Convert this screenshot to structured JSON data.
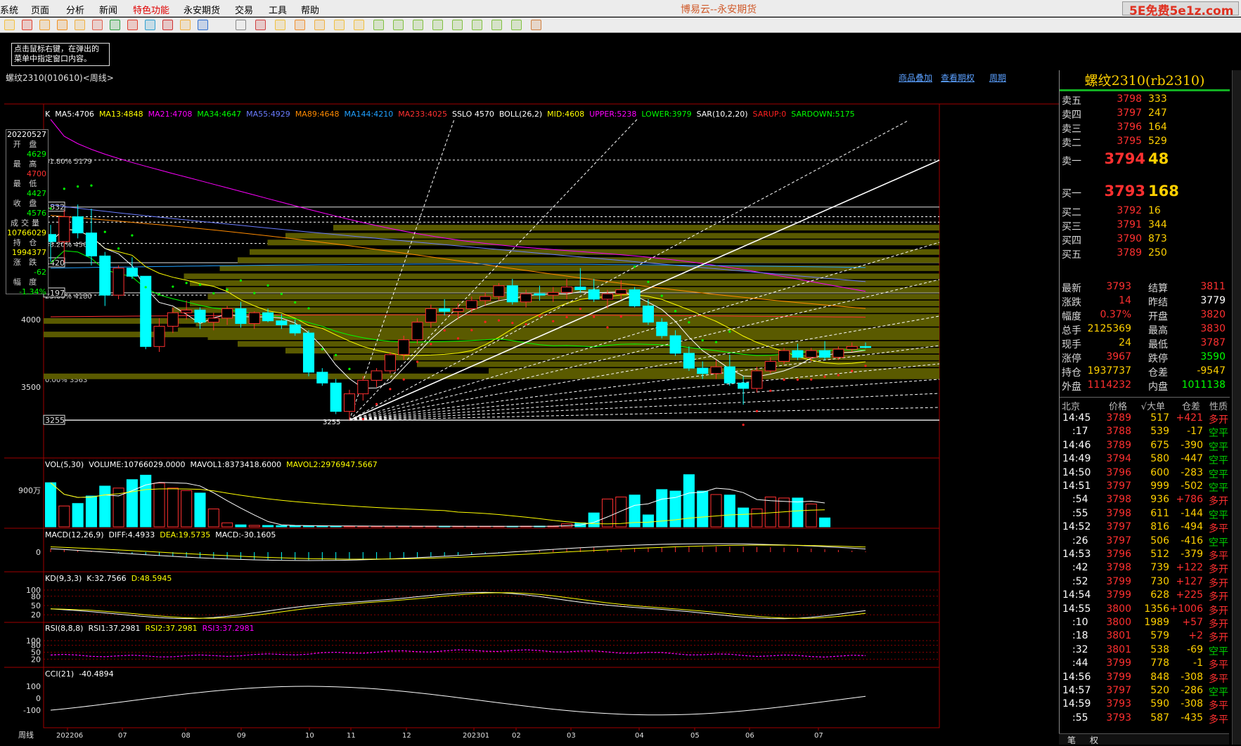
{
  "app": {
    "title": "博易云--永安期货",
    "watermark": "5E免费5e1z.com"
  },
  "menu": [
    "系统",
    "页面",
    "分析",
    "新闻",
    "特色功能",
    "永安期货",
    "交易",
    "工具",
    "帮助"
  ],
  "hint": {
    "line1": "点击鼠标右键，在弹出的",
    "line2": "菜单中指定窗口内容。"
  },
  "chart": {
    "title": "螺纹2310(010610)<周线>",
    "links": [
      "商品叠加",
      "查看期权",
      "周期"
    ],
    "ma_legend": [
      {
        "t": "K",
        "c": "#ffffff"
      },
      {
        "t": "MA5:4706",
        "c": "#ffffff"
      },
      {
        "t": "MA13:4848",
        "c": "#ffff00"
      },
      {
        "t": "MA21:4708",
        "c": "#ff00ff"
      },
      {
        "t": "MA34:4647",
        "c": "#00ff00"
      },
      {
        "t": "MA55:4929",
        "c": "#6a7cff"
      },
      {
        "t": "MA89:4648",
        "c": "#ff8a00"
      },
      {
        "t": "MA144:4210",
        "c": "#20a0ff"
      },
      {
        "t": "MA233:4025",
        "c": "#ff3030"
      },
      {
        "t": "SSLO 4570",
        "c": "#ffffff"
      },
      {
        "t": "BOLL(26,2)",
        "c": "#ffffff"
      },
      {
        "t": "MID:4608",
        "c": "#ffff00"
      },
      {
        "t": "UPPER:5238",
        "c": "#ff00ff"
      },
      {
        "t": "LOWER:3979",
        "c": "#00ff00"
      },
      {
        "t": "SAR(10,2,20)",
        "c": "#ffffff"
      },
      {
        "t": "SARUP:0",
        "c": "#ff2020"
      },
      {
        "t": "SARDOWN:5175",
        "c": "#00ff00"
      }
    ],
    "price_labels": [
      "4000",
      "3500"
    ],
    "price_boxes": [
      "4832",
      "4420",
      "4197",
      "3255"
    ],
    "fib": [
      "61.80% 5179",
      "38.20% 4562",
      "23.60% 4180",
      "0.00% 3563"
    ],
    "low_mark": "3255",
    "vol_legend": [
      {
        "t": "VOL(5,30)",
        "c": "#ffffff"
      },
      {
        "t": "VOLUME:10766029.0000",
        "c": "#ffffff"
      },
      {
        "t": "MAVOL1:8373418.6000",
        "c": "#ffffff"
      },
      {
        "t": "MAVOL2:2976947.5667",
        "c": "#ffff00"
      }
    ],
    "vol_label": "900万",
    "macd_legend": [
      {
        "t": "MACD(12,26,9)",
        "c": "#ffffff"
      },
      {
        "t": "DIFF:4.4933",
        "c": "#ffffff"
      },
      {
        "t": "DEA:19.5735",
        "c": "#ffff00"
      },
      {
        "t": "MACD:-30.1605",
        "c": "#ffffff"
      }
    ],
    "macd_label": "0",
    "kd_legend": [
      {
        "t": "KD(9,3,3)",
        "c": "#ffffff"
      },
      {
        "t": "K:32.7566",
        "c": "#ffffff"
      },
      {
        "t": "D:48.5945",
        "c": "#ffff00"
      }
    ],
    "kd_labels": [
      "100",
      "80",
      "50",
      "20"
    ],
    "rsi_legend": [
      {
        "t": "RSI(8,8,8)",
        "c": "#ffffff"
      },
      {
        "t": "RSI1:37.2981",
        "c": "#ffffff"
      },
      {
        "t": "RSI2:37.2981",
        "c": "#ffff00"
      },
      {
        "t": "RSI3:37.2981",
        "c": "#ff00ff"
      }
    ],
    "rsi_labels": [
      "100",
      "80",
      "50",
      "20"
    ],
    "cci_legend": [
      {
        "t": "CCI(21)",
        "c": "#ffffff"
      },
      {
        "t": "-40.4894",
        "c": "#ffffff"
      }
    ],
    "cci_labels": [
      "100",
      "0",
      "-100"
    ],
    "period_label": "周线",
    "x_labels": [
      "202206",
      "07",
      "08",
      "09",
      "10",
      "11",
      "12",
      "202301",
      "02",
      "03",
      "04",
      "05",
      "06",
      "07"
    ]
  },
  "datawin": [
    {
      "t": "20220527",
      "c": "#ffffff",
      "lab": false
    },
    {
      "t": "开 盘",
      "lab": true
    },
    {
      "t": "4629",
      "c": "#00ff00"
    },
    {
      "t": "最 高",
      "lab": true
    },
    {
      "t": "4700",
      "c": "#ff3030"
    },
    {
      "t": "最 低",
      "lab": true
    },
    {
      "t": "4427",
      "c": "#00ff00"
    },
    {
      "t": "收 盘",
      "lab": true
    },
    {
      "t": "4576",
      "c": "#00ff00"
    },
    {
      "t": "成交量",
      "lab": true
    },
    {
      "t": "10766029",
      "c": "#ffff00"
    },
    {
      "t": "持 仓",
      "lab": true
    },
    {
      "t": "1994377",
      "c": "#ffff00"
    },
    {
      "t": "涨 跌",
      "lab": true
    },
    {
      "t": "-62",
      "c": "#00ff00"
    },
    {
      "t": "幅 度",
      "lab": true
    },
    {
      "t": "-1.34%",
      "c": "#00ff00"
    }
  ],
  "quote": {
    "title": "螺纹2310(rb2310)",
    "asks": [
      {
        "l": "卖五",
        "p": "3798",
        "v": "333"
      },
      {
        "l": "卖四",
        "p": "3797",
        "v": "247"
      },
      {
        "l": "卖三",
        "p": "3796",
        "v": "164"
      },
      {
        "l": "卖二",
        "p": "3795",
        "v": "529"
      },
      {
        "l": "卖一",
        "p": "3794",
        "v": "48"
      }
    ],
    "bids": [
      {
        "l": "买一",
        "p": "3793",
        "v": "168"
      },
      {
        "l": "买二",
        "p": "3792",
        "v": "16"
      },
      {
        "l": "买三",
        "p": "3791",
        "v": "344"
      },
      {
        "l": "买四",
        "p": "3790",
        "v": "873"
      },
      {
        "l": "买五",
        "p": "3789",
        "v": "250"
      }
    ],
    "stats": [
      {
        "a": "最新",
        "av": "3793",
        "ac": "#ff3030",
        "b": "结算",
        "bv": "3811",
        "bc": "#ff3030"
      },
      {
        "a": "涨跌",
        "av": "14",
        "ac": "#ff3030",
        "b": "昨结",
        "bv": "3779",
        "bc": "#ffffff"
      },
      {
        "a": "幅度",
        "av": "0.37%",
        "ac": "#ff3030",
        "b": "开盘",
        "bv": "3820",
        "bc": "#ff3030"
      },
      {
        "a": "总手",
        "av": "2125369",
        "ac": "#ffd000",
        "b": "最高",
        "bv": "3830",
        "bc": "#ff3030"
      },
      {
        "a": "现手",
        "av": "24",
        "ac": "#ffd000",
        "b": "最低",
        "bv": "3787",
        "bc": "#ff3030"
      },
      {
        "a": "涨停",
        "av": "3967",
        "ac": "#ff3030",
        "b": "跌停",
        "bv": "3590",
        "bc": "#00ff00"
      },
      {
        "a": "持仓",
        "av": "1937737",
        "ac": "#ffd000",
        "b": "仓差",
        "bv": "-9547",
        "bc": "#ffd000"
      },
      {
        "a": "外盘",
        "av": "1114232",
        "ac": "#ff3030",
        "b": "内盘",
        "bv": "1011138",
        "bc": "#00ff00"
      }
    ],
    "tick_header": [
      "北京",
      "价格",
      "√大单",
      "仓差",
      "性质"
    ],
    "ticks": [
      {
        "t": "14:45",
        "p": "3789",
        "v": "517",
        "c": "+421",
        "ty": "多开"
      },
      {
        "t": ":17",
        "p": "3788",
        "v": "539",
        "c": "-17",
        "ty": "空平"
      },
      {
        "t": "14:46",
        "p": "3789",
        "v": "675",
        "c": "-390",
        "ty": "空平"
      },
      {
        "t": "14:49",
        "p": "3794",
        "v": "580",
        "c": "-447",
        "ty": "空平"
      },
      {
        "t": "14:50",
        "p": "3796",
        "v": "600",
        "c": "-283",
        "ty": "空平"
      },
      {
        "t": "14:51",
        "p": "3797",
        "v": "999",
        "c": "-502",
        "ty": "空平"
      },
      {
        "t": ":54",
        "p": "3798",
        "v": "936",
        "c": "+786",
        "ty": "多开"
      },
      {
        "t": ":55",
        "p": "3798",
        "v": "611",
        "c": "-144",
        "ty": "空平"
      },
      {
        "t": "14:52",
        "p": "3797",
        "v": "816",
        "c": "-494",
        "ty": "多平"
      },
      {
        "t": ":26",
        "p": "3797",
        "v": "506",
        "c": "-416",
        "ty": "空平"
      },
      {
        "t": "14:53",
        "p": "3796",
        "v": "512",
        "c": "-379",
        "ty": "多平"
      },
      {
        "t": ":42",
        "p": "3798",
        "v": "739",
        "c": "+122",
        "ty": "多开"
      },
      {
        "t": ":52",
        "p": "3799",
        "v": "730",
        "c": "+127",
        "ty": "多开"
      },
      {
        "t": "14:54",
        "p": "3799",
        "v": "628",
        "c": "+225",
        "ty": "多开"
      },
      {
        "t": "14:55",
        "p": "3800",
        "v": "1356",
        "c": "+1006",
        "ty": "多开"
      },
      {
        "t": ":10",
        "p": "3800",
        "v": "1989",
        "c": "+57",
        "ty": "多开"
      },
      {
        "t": ":18",
        "p": "3801",
        "v": "579",
        "c": "+2",
        "ty": "多开"
      },
      {
        "t": ":32",
        "p": "3801",
        "v": "538",
        "c": "-69",
        "ty": "空平"
      },
      {
        "t": ":44",
        "p": "3799",
        "v": "778",
        "c": "-1",
        "ty": "多平"
      },
      {
        "t": "14:56",
        "p": "3799",
        "v": "848",
        "c": "-308",
        "ty": "多平"
      },
      {
        "t": "14:57",
        "p": "3797",
        "v": "520",
        "c": "-286",
        "ty": "空平"
      },
      {
        "t": "14:59",
        "p": "3793",
        "v": "590",
        "c": "-308",
        "ty": "多平"
      },
      {
        "t": ":55",
        "p": "3793",
        "v": "587",
        "c": "-435",
        "ty": "多平"
      }
    ],
    "tabs": [
      "笔",
      "权"
    ]
  },
  "chart_data": {
    "type": "candlestick",
    "candles": [
      [
        4629,
        4700,
        4427,
        4576
      ],
      [
        4576,
        4810,
        4420,
        4760
      ],
      [
        4760,
        4850,
        4600,
        4640
      ],
      [
        4640,
        4820,
        4400,
        4470
      ],
      [
        4470,
        4500,
        4100,
        4180
      ],
      [
        4180,
        4400,
        4150,
        4380
      ],
      [
        4380,
        4460,
        4300,
        4320
      ],
      [
        4320,
        4100,
        3780,
        3800
      ],
      [
        3800,
        4010,
        3760,
        3950
      ],
      [
        3950,
        4090,
        3900,
        4050
      ],
      [
        4050,
        4140,
        4000,
        4070
      ],
      [
        4070,
        4090,
        3930,
        3980
      ],
      [
        3980,
        4050,
        3920,
        4010
      ],
      [
        4010,
        4100,
        3960,
        4080
      ],
      [
        4080,
        4130,
        3940,
        3970
      ],
      [
        3970,
        4060,
        3930,
        4050
      ],
      [
        4050,
        4080,
        3980,
        3990
      ],
      [
        3990,
        4040,
        3930,
        3960
      ],
      [
        3960,
        4000,
        3880,
        3900
      ],
      [
        3900,
        3920,
        3580,
        3610
      ],
      [
        3610,
        3640,
        3510,
        3530
      ],
      [
        3530,
        3560,
        3300,
        3320
      ],
      [
        3320,
        3480,
        3255,
        3450
      ],
      [
        3450,
        3580,
        3400,
        3550
      ],
      [
        3550,
        3640,
        3500,
        3620
      ],
      [
        3620,
        3760,
        3600,
        3740
      ],
      [
        3740,
        3880,
        3700,
        3850
      ],
      [
        3850,
        4010,
        3820,
        3980
      ],
      [
        3980,
        4110,
        3940,
        4080
      ],
      [
        4080,
        4150,
        4030,
        4060
      ],
      [
        4060,
        4120,
        4000,
        4080
      ],
      [
        4080,
        4170,
        4050,
        4140
      ],
      [
        4140,
        4200,
        4100,
        4170
      ],
      [
        4170,
        4270,
        4140,
        4250
      ],
      [
        4250,
        4300,
        4110,
        4130
      ],
      [
        4130,
        4220,
        4090,
        4190
      ],
      [
        4190,
        4250,
        4140,
        4180
      ],
      [
        4180,
        4240,
        4130,
        4200
      ],
      [
        4200,
        4300,
        4150,
        4240
      ],
      [
        4240,
        4380,
        4200,
        4220
      ],
      [
        4220,
        4300,
        4130,
        4150
      ],
      [
        4150,
        4220,
        4080,
        4190
      ],
      [
        4190,
        4290,
        4150,
        4220
      ],
      [
        4220,
        4240,
        4090,
        4100
      ],
      [
        4100,
        4150,
        3960,
        3980
      ],
      [
        3980,
        4010,
        3860,
        3880
      ],
      [
        3880,
        3920,
        3730,
        3750
      ],
      [
        3750,
        3800,
        3620,
        3640
      ],
      [
        3640,
        3690,
        3560,
        3600
      ],
      [
        3600,
        3700,
        3560,
        3650
      ],
      [
        3650,
        3740,
        3510,
        3530
      ],
      [
        3530,
        3580,
        3370,
        3490
      ],
      [
        3490,
        3650,
        3460,
        3620
      ],
      [
        3620,
        3720,
        3600,
        3690
      ],
      [
        3690,
        3790,
        3670,
        3770
      ],
      [
        3770,
        3820,
        3700,
        3720
      ],
      [
        3720,
        3790,
        3690,
        3770
      ],
      [
        3770,
        3840,
        3700,
        3720
      ],
      [
        3720,
        3800,
        3700,
        3780
      ],
      [
        3780,
        3830,
        3760,
        3800
      ],
      [
        3800,
        3830,
        3787,
        3793
      ]
    ],
    "volume_wan": [
      888,
      420,
      470,
      620,
      820,
      780,
      950,
      1040,
      880,
      780,
      730,
      680,
      360,
      80,
      40,
      30,
      28,
      24,
      20,
      18,
      16,
      15,
      15,
      14,
      14,
      13,
      13,
      12,
      12,
      11,
      11,
      10,
      10,
      10,
      10,
      12,
      14,
      16,
      60,
      80,
      280,
      560,
      600,
      640,
      240,
      750,
      720,
      1050,
      720,
      650,
      640,
      380,
      360,
      600,
      580,
      580,
      460,
      180
    ],
    "ylim": [
      3255,
      5300
    ]
  }
}
